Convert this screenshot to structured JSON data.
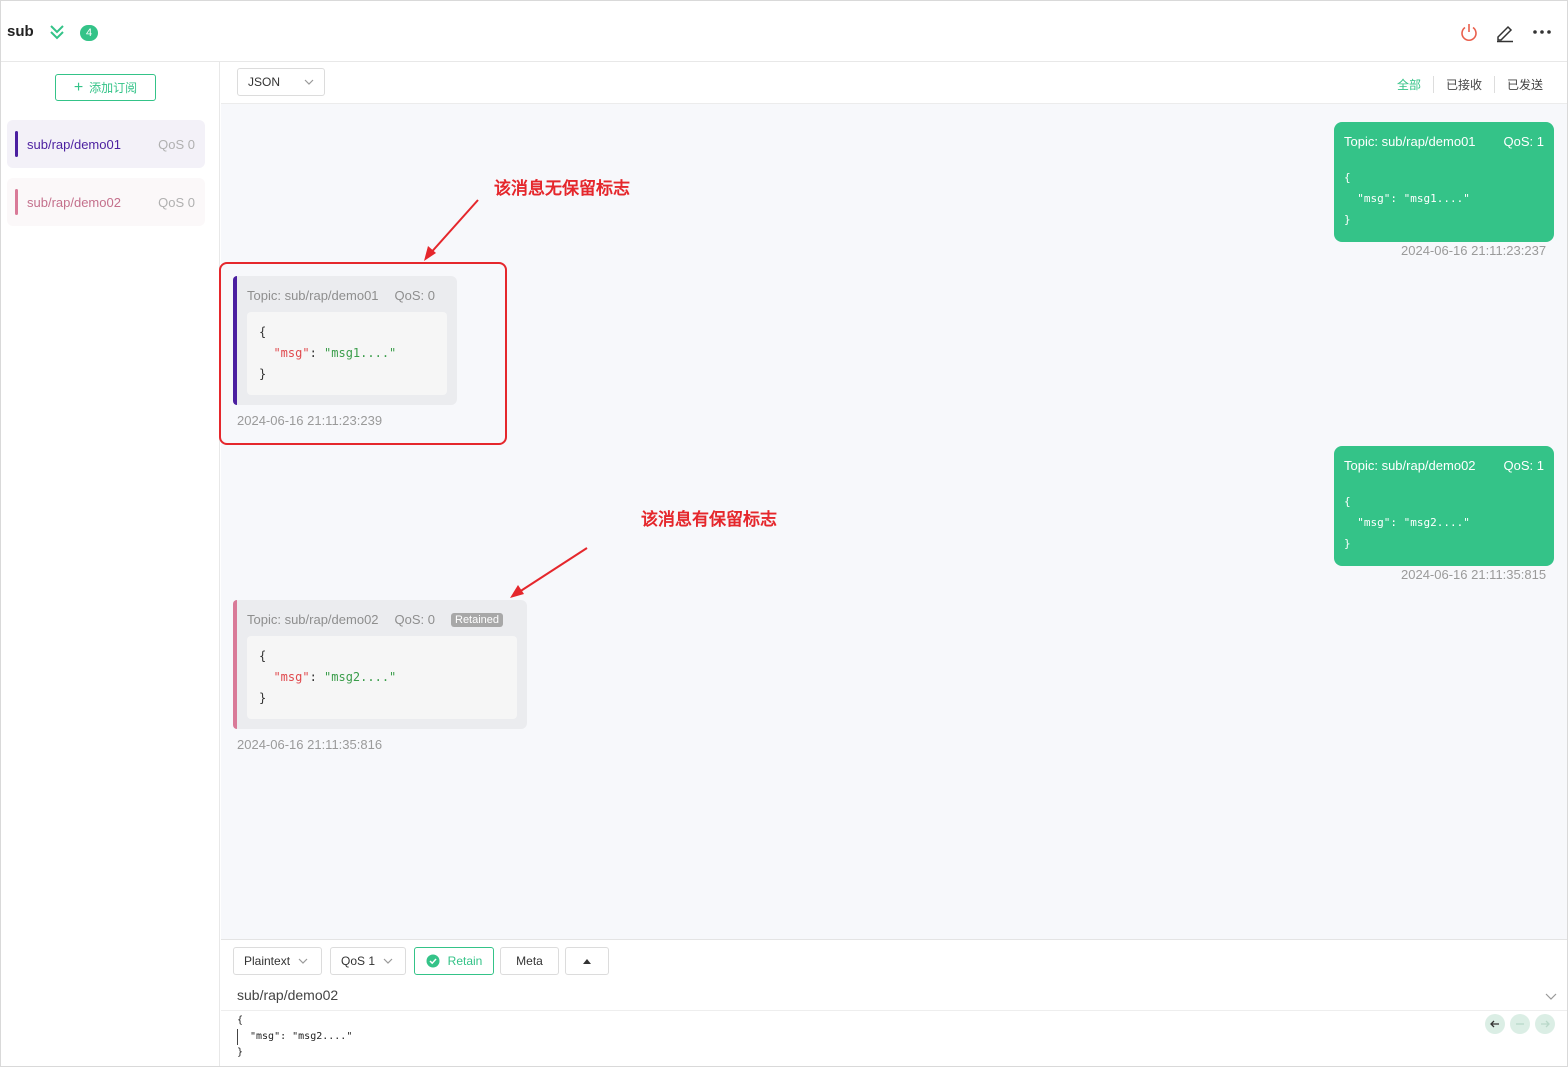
{
  "header": {
    "connection_name": "sub",
    "subscription_count": "4"
  },
  "sidebar": {
    "add_subscription_label": "添加订阅",
    "subscriptions": [
      {
        "topic": "sub/rap/demo01",
        "qos": "QoS 0",
        "color": "#4b1fa0"
      },
      {
        "topic": "sub/rap/demo02",
        "qos": "QoS 0",
        "color": "#d97a98"
      }
    ]
  },
  "toolbar": {
    "format": "JSON",
    "filters": [
      "全部",
      "已接收",
      "已发送"
    ],
    "active_filter": "全部"
  },
  "messages": [
    {
      "direction": "sent",
      "topic": "Topic: sub/rap/demo01",
      "qos": "QoS: 1",
      "payload": [
        "{",
        "  \"msg\": \"msg1....\"",
        "}"
      ],
      "time": "2024-06-16 21:11:23:237"
    },
    {
      "direction": "received",
      "topic": "Topic: sub/rap/demo01",
      "qos": "QoS: 0",
      "retained": false,
      "key": "\"msg\"",
      "value": "\"msg1....\"",
      "open": "{",
      "close": "}",
      "time": "2024-06-16 21:11:23:239"
    },
    {
      "direction": "sent",
      "topic": "Topic: sub/rap/demo02",
      "qos": "QoS: 1",
      "payload": [
        "{",
        "  \"msg\": \"msg2....\"",
        "}"
      ],
      "time": "2024-06-16 21:11:35:815"
    },
    {
      "direction": "received",
      "topic": "Topic: sub/rap/demo02",
      "qos": "QoS: 0",
      "retained": true,
      "retained_label": "Retained",
      "key": "\"msg\"",
      "value": "\"msg2....\"",
      "open": "{",
      "close": "}",
      "time": "2024-06-16 21:11:35:816"
    }
  ],
  "annotations": {
    "no_retain": "该消息无保留标志",
    "has_retain": "该消息有保留标志"
  },
  "composer": {
    "payload_type": "Plaintext",
    "qos": "QoS 1",
    "retain_label": "Retain",
    "meta_label": "Meta",
    "topic": "sub/rap/demo02",
    "payload_lines": [
      "{",
      "\"msg\": \"msg2....\"",
      "}"
    ]
  },
  "colors": {
    "accent": "#34c388",
    "annotation": "#e5272c"
  }
}
